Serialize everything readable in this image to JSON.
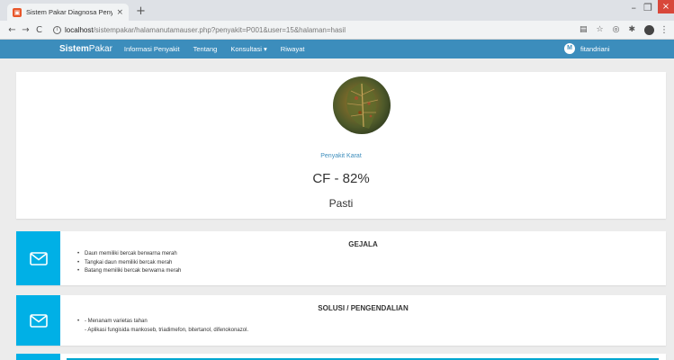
{
  "browser": {
    "tab_title": "Sistem Pakar Diagnosa Penyakit",
    "tab_close": "×",
    "new_tab": "+",
    "url_host": "localhost",
    "url_path": "/sistempakar/halamanutamauser.php?penyakit=P001&user=15&halaman=hasil",
    "win_min": "–",
    "win_max": "❐",
    "win_close": "×"
  },
  "navbar": {
    "brand_bold": "Sistem",
    "brand_rest": "Pakar",
    "links": [
      "Informasi Penyakit",
      "Tentang",
      "Konsultasi ▾",
      "Riwayat"
    ],
    "user_initial": "M",
    "user_name": "fitandriani"
  },
  "result": {
    "disease_name": "Penyakit Karat",
    "cf": "CF - 82%",
    "certainty": "Pasti"
  },
  "gejala": {
    "title": "GEJALA",
    "items": [
      "Daun memiliki bercak berwarna merah",
      "Tangkai daun memiliki bercak merah",
      "Batang memiliki bercak berwarna merah"
    ]
  },
  "solusi": {
    "title": "SOLUSI / PENGENDALIAN",
    "items": [
      "- Menanam varietas tahan",
      "- Aplikasi fungisida mankoseb, triadimefon, bitertanol, difenokonazol."
    ]
  },
  "colors": {
    "navbar": "#3c8dbc",
    "info_icon_bg": "#00b0e6",
    "link": "#3c8dbc"
  },
  "icons": {
    "box_icon": "envelope-icon"
  }
}
